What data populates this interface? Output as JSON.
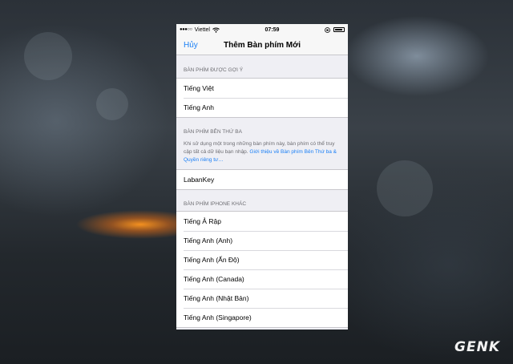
{
  "status_bar": {
    "carrier": "Viettel",
    "signal": "●●●○○",
    "time": "07:59",
    "lock_icon": "orientation-lock-icon",
    "wifi_icon": "wifi-icon",
    "battery_icon": "battery-icon"
  },
  "navbar": {
    "cancel_label": "Hủy",
    "title": "Thêm Bàn phím Mới"
  },
  "sections": {
    "suggested": {
      "header": "BÀN PHÍM ĐƯỢC GỢI Ý",
      "items": [
        "Tiếng Việt",
        "Tiếng Anh"
      ]
    },
    "third_party": {
      "header": "BÀN PHÍM BÊN THỨ BA",
      "description": "Khi sử dụng một trong những bàn phím này, bàn phím có thể truy cập tất cả dữ liệu bạn nhập.",
      "link": "Giới thiệu về Bàn phím Bên Thứ ba & Quyền riêng tư…",
      "items": [
        "LabanKey"
      ]
    },
    "other": {
      "header": "BÀN PHÍM IPHONE KHÁC",
      "items": [
        "Tiếng Ả Rập",
        "Tiếng Anh (Anh)",
        "Tiếng Anh (Ấn Độ)",
        "Tiếng Anh (Canada)",
        "Tiếng Anh (Nhật Bản)",
        "Tiếng Anh (Singapore)"
      ]
    }
  },
  "watermark": "GENK",
  "colors": {
    "accent": "#1a7ff6",
    "group_background": "#efeff4",
    "header_text": "#6d6d72"
  }
}
